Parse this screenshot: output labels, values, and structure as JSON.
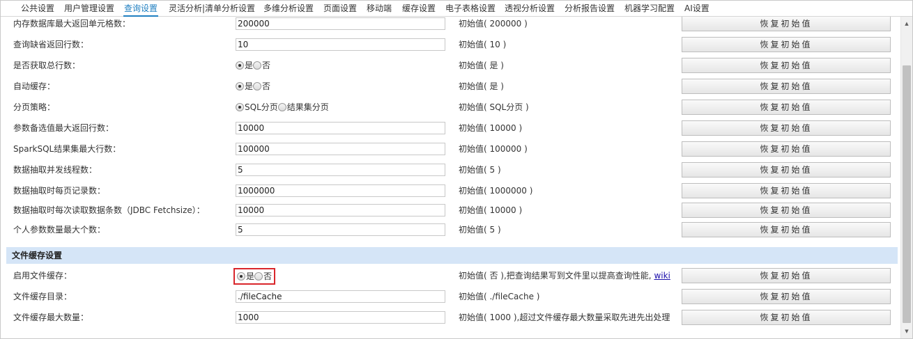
{
  "tabs": [
    {
      "label": "公共设置"
    },
    {
      "label": "用户管理设置"
    },
    {
      "label": "查询设置"
    },
    {
      "label": "灵活分析|清单分析设置"
    },
    {
      "label": "多维分析设置"
    },
    {
      "label": "页面设置"
    },
    {
      "label": "移动端"
    },
    {
      "label": "缓存设置"
    },
    {
      "label": "电子表格设置"
    },
    {
      "label": "透视分析设置"
    },
    {
      "label": "分析报告设置"
    },
    {
      "label": "机器学习配置"
    },
    {
      "label": "AI设置"
    }
  ],
  "active_tab": "查询设置",
  "restore_label": "恢复初始值",
  "radio_yes": "是",
  "radio_no": "否",
  "rows": [
    {
      "label": "内存数据库最大返回单元格数：",
      "value": "200000",
      "default": "初始值( 200000 )"
    },
    {
      "label": "查询缺省返回行数：",
      "value": "10",
      "default": "初始值( 10 )"
    },
    {
      "label": "是否获取总行数：",
      "default": "初始值( 是 )"
    },
    {
      "label": "自动缓存：",
      "default": "初始值( 是 )"
    },
    {
      "label": "分页策略：",
      "option_a": "SQL分页",
      "option_b": "结果集分页",
      "default": "初始值( SQL分页 )"
    },
    {
      "label": "参数备选值最大返回行数：",
      "value": "10000",
      "default": "初始值( 10000 )"
    },
    {
      "label": "SparkSQL结果集最大行数：",
      "value": "100000",
      "default": "初始值( 100000 )"
    },
    {
      "label": "数据抽取并发线程数：",
      "value": "5",
      "default": "初始值( 5 )"
    },
    {
      "label": "数据抽取时每页记录数：",
      "value": "1000000",
      "default": "初始值( 1000000 )"
    },
    {
      "label": "数据抽取时每次读取数据条数（JDBC Fetchsize）：",
      "value": "10000",
      "default": "初始值( 10000 )"
    },
    {
      "label": "个人参数数量最大个数：",
      "value": "5",
      "default": "初始值( 5 )"
    }
  ],
  "section_title": "文件缓存设置",
  "file_rows": [
    {
      "label": "启用文件缓存：",
      "default": "初始值( 否 ),把查询结果写到文件里以提高查询性能,",
      "link": "wiki"
    },
    {
      "label": "文件缓存目录：",
      "value": "./fileCache",
      "default": "初始值( ./fileCache )"
    },
    {
      "label": "文件缓存最大数量：",
      "value": "1000",
      "default": "初始值( 1000 ),超过文件缓存最大数量采取先进先出处理"
    }
  ]
}
